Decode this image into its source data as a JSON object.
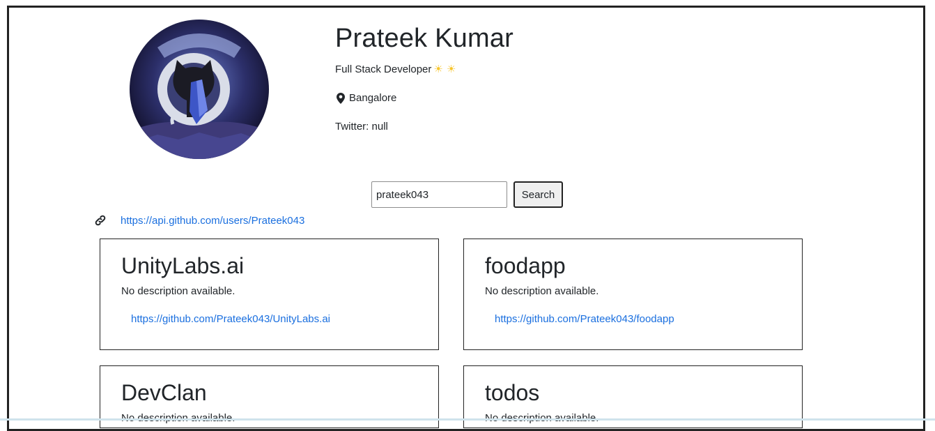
{
  "profile": {
    "name": "Prateek Kumar",
    "bio": "Full Stack Developer",
    "location": "Bangalore",
    "twitter": "Twitter: null"
  },
  "search": {
    "value": "prateek043",
    "button_label": "Search"
  },
  "api_link": "https://api.github.com/users/Prateek043",
  "repos": [
    {
      "name": "UnityLabs.ai",
      "description": "No description available.",
      "url": "https://github.com/Prateek043/UnityLabs.ai"
    },
    {
      "name": "foodapp",
      "description": "No description available.",
      "url": "https://github.com/Prateek043/foodapp"
    },
    {
      "name": "DevClan",
      "description": "No description available.",
      "url": ""
    },
    {
      "name": "todos",
      "description": "No description available.",
      "url": ""
    }
  ],
  "icons": {
    "avatar": "github-octocat-avatar",
    "sun": "sun-emoji",
    "location": "map-pin-icon",
    "link": "link-icon"
  },
  "colors": {
    "link": "#1a6fdf",
    "border": "#222222",
    "sun": "#f7c52b"
  }
}
